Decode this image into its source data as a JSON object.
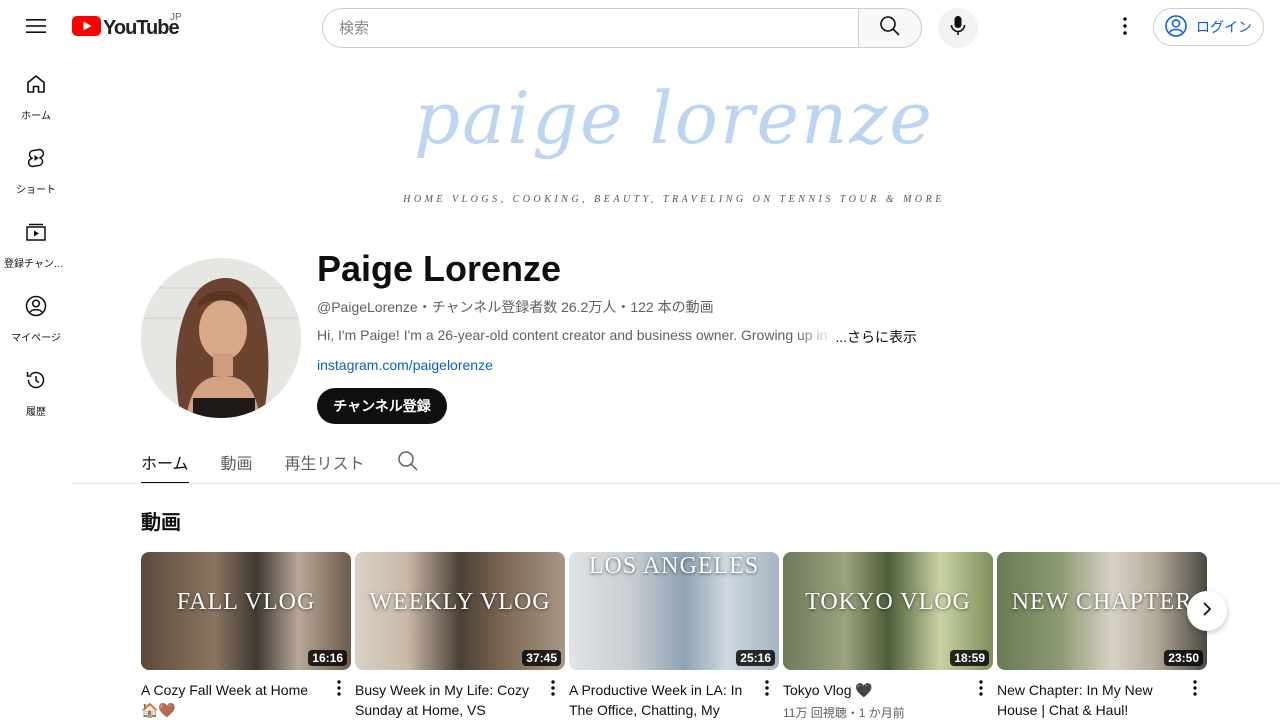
{
  "header": {
    "logo_text": "YouTube",
    "region": "JP",
    "search_placeholder": "検索",
    "login_label": "ログイン"
  },
  "sidebar": {
    "items": [
      {
        "label": "ホーム",
        "icon": "home-icon"
      },
      {
        "label": "ショート",
        "icon": "shorts-icon"
      },
      {
        "label": "登録チャンネル",
        "icon": "subscriptions-icon"
      },
      {
        "label": "マイページ",
        "icon": "account-icon"
      },
      {
        "label": "履歴",
        "icon": "history-icon"
      }
    ]
  },
  "banner": {
    "title": "paige lorenze",
    "subtitle": "HOME VLOGS, COOKING, BEAUTY, TRAVELING ON TENNIS TOUR & MORE",
    "title_color": "#bcd6f1"
  },
  "channel": {
    "name": "Paige Lorenze",
    "meta": "@PaigeLorenze・チャンネル登録者数 26.2万人・122 本の動画",
    "description": "Hi, I'm Paige! I'm a 26-year-old content creator and business owner. Growing up in V",
    "more_label": "...さらに表示",
    "link": "instagram.com/paigelorenze",
    "subscribe_label": "チャンネル登録"
  },
  "tabs": [
    {
      "label": "ホーム",
      "active": true
    },
    {
      "label": "動画",
      "active": false
    },
    {
      "label": "再生リスト",
      "active": false
    }
  ],
  "section": {
    "title": "動画"
  },
  "videos": [
    {
      "overlay": "FALL VLOG",
      "duration": "16:16",
      "title": "A Cozy Fall Week at Home 🏠🤎",
      "meta": ""
    },
    {
      "overlay": "WEEKLY VLOG",
      "duration": "37:45",
      "title": "Busy Week in My Life: Cozy Sunday at Home, VS Fashio…",
      "meta": ""
    },
    {
      "overlay": "LOS ANGELES",
      "duration": "25:16",
      "title": "A Productive Week in LA: In The Office, Chatting, My LA…",
      "meta": ""
    },
    {
      "overlay": "TOKYO VLOG",
      "duration": "18:59",
      "title": "Tokyo Vlog 🖤",
      "meta": "11万 回視聴・1 か月前"
    },
    {
      "overlay": "NEW CHAPTER",
      "duration": "23:50",
      "title": "New Chapter: In My New House | Chat & Haul!",
      "meta": ""
    }
  ],
  "colors": {
    "accent_red": "#ff0000",
    "link_blue": "#065fd4",
    "text_primary": "#0f0f0f",
    "text_secondary": "#606060"
  }
}
